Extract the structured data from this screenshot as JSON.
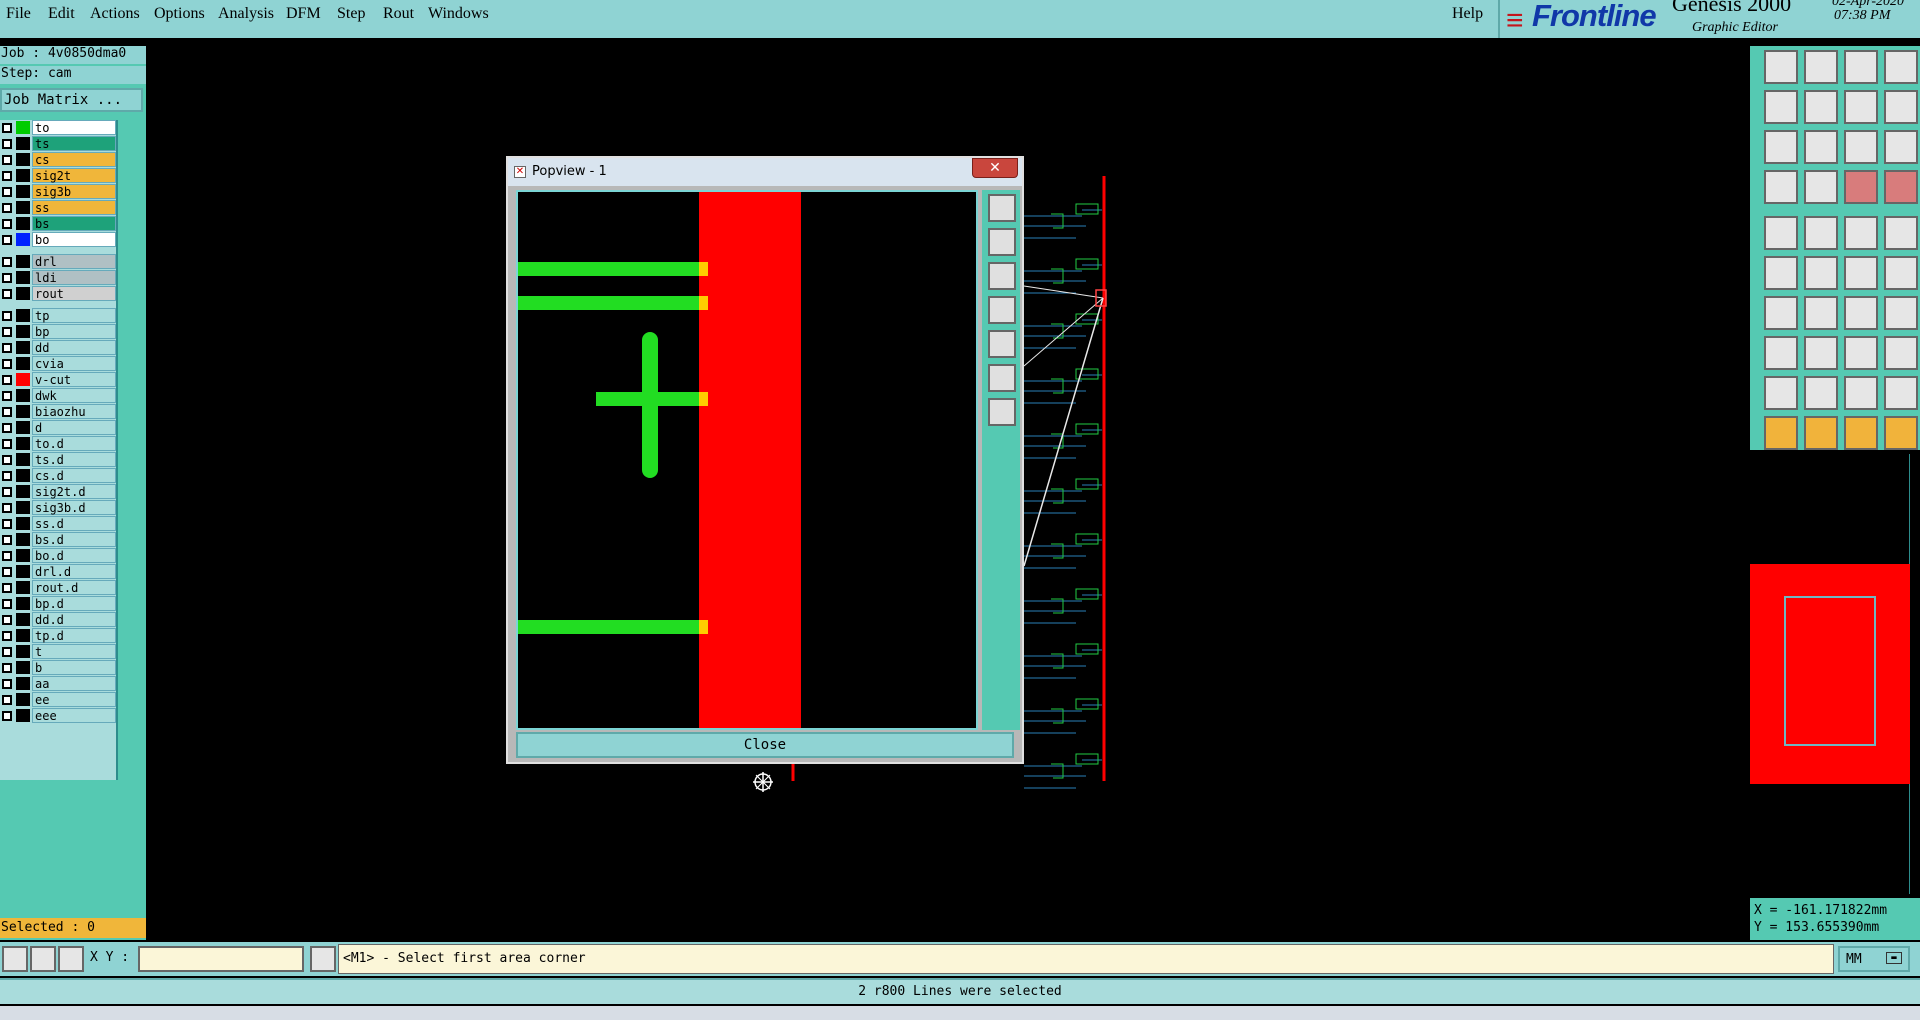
{
  "menu": {
    "items": [
      "File",
      "Edit",
      "Actions",
      "Options",
      "Analysis",
      "DFM",
      "Step",
      "Rout",
      "Windows"
    ],
    "help": "Help"
  },
  "logo": {
    "brand": "Frontline",
    "product": "Genesis 2000",
    "subtitle": "Graphic Editor",
    "date": "02-Apr-2020",
    "time": "07:38 PM"
  },
  "job": {
    "job_line": "Job : 4v0850dma0",
    "step_line": "Step: cam",
    "matrix_button": "Job Matrix ..."
  },
  "layers": [
    {
      "name": "to",
      "swatch": "#00cc00",
      "bg": "#ffffff"
    },
    {
      "name": "ts",
      "swatch": "#000000",
      "bg": "#1ea27a"
    },
    {
      "name": "cs",
      "swatch": "#000000",
      "bg": "#f0b63a"
    },
    {
      "name": "sig2t",
      "swatch": "#000000",
      "bg": "#f0b63a"
    },
    {
      "name": "sig3b",
      "swatch": "#000000",
      "bg": "#f0b63a"
    },
    {
      "name": "ss",
      "swatch": "#000000",
      "bg": "#f0b63a"
    },
    {
      "name": "bs",
      "swatch": "#000000",
      "bg": "#1ea27a"
    },
    {
      "name": "bo",
      "swatch": "#0022ff",
      "bg": "#ffffff"
    },
    {
      "name": "drl",
      "swatch": "#000000",
      "bg": "#b0c0c4"
    },
    {
      "name": "ldi",
      "swatch": "#000000",
      "bg": "#b0c0c4"
    },
    {
      "name": "rout",
      "swatch": "#000000",
      "bg": "#d0d0d0"
    },
    {
      "name": "tp",
      "swatch": "#000000",
      "bg": "#a9dcdc"
    },
    {
      "name": "bp",
      "swatch": "#000000",
      "bg": "#a9dcdc"
    },
    {
      "name": "dd",
      "swatch": "#000000",
      "bg": "#a9dcdc"
    },
    {
      "name": "cvia",
      "swatch": "#000000",
      "bg": "#a9dcdc"
    },
    {
      "name": "v-cut",
      "swatch": "#ff0000",
      "bg": "#a9dcdc"
    },
    {
      "name": "dwk",
      "swatch": "#000000",
      "bg": "#a9dcdc"
    },
    {
      "name": "biaozhu",
      "swatch": "#000000",
      "bg": "#a9dcdc"
    },
    {
      "name": "d",
      "swatch": "#000000",
      "bg": "#a9dcdc"
    },
    {
      "name": "to.d",
      "swatch": "#000000",
      "bg": "#a9dcdc"
    },
    {
      "name": "ts.d",
      "swatch": "#000000",
      "bg": "#a9dcdc"
    },
    {
      "name": "cs.d",
      "swatch": "#000000",
      "bg": "#a9dcdc"
    },
    {
      "name": "sig2t.d",
      "swatch": "#000000",
      "bg": "#a9dcdc"
    },
    {
      "name": "sig3b.d",
      "swatch": "#000000",
      "bg": "#a9dcdc"
    },
    {
      "name": "ss.d",
      "swatch": "#000000",
      "bg": "#a9dcdc"
    },
    {
      "name": "bs.d",
      "swatch": "#000000",
      "bg": "#a9dcdc"
    },
    {
      "name": "bo.d",
      "swatch": "#000000",
      "bg": "#a9dcdc"
    },
    {
      "name": "drl.d",
      "swatch": "#000000",
      "bg": "#a9dcdc"
    },
    {
      "name": "rout.d",
      "swatch": "#000000",
      "bg": "#a9dcdc"
    },
    {
      "name": "bp.d",
      "swatch": "#000000",
      "bg": "#a9dcdc"
    },
    {
      "name": "dd.d",
      "swatch": "#000000",
      "bg": "#a9dcdc"
    },
    {
      "name": "tp.d",
      "swatch": "#000000",
      "bg": "#a9dcdc"
    },
    {
      "name": "t",
      "swatch": "#000000",
      "bg": "#a9dcdc"
    },
    {
      "name": "b",
      "swatch": "#000000",
      "bg": "#a9dcdc"
    },
    {
      "name": "aa",
      "swatch": "#000000",
      "bg": "#a9dcdc"
    },
    {
      "name": "ee",
      "swatch": "#000000",
      "bg": "#a9dcdc"
    },
    {
      "name": "eee",
      "swatch": "#000000",
      "bg": "#a9dcdc"
    }
  ],
  "selected": "Selected : 0",
  "popview": {
    "title": "Popview - 1",
    "close_button": "Close",
    "close_x": "✕"
  },
  "coords": {
    "x": "X = -161.171822mm",
    "y": "Y = 153.655390mm"
  },
  "input": {
    "xy_label": "X Y :",
    "xy_value": "",
    "prompt": "<M1> - Select first area corner",
    "unit": "MM"
  },
  "status": "2 r800 Lines were selected",
  "colors": {
    "accent": "#8fd3d3",
    "panel": "#55c9b2",
    "highlight": "#f0b63a",
    "copper": "#00dd00",
    "vcut": "#ff0000"
  }
}
